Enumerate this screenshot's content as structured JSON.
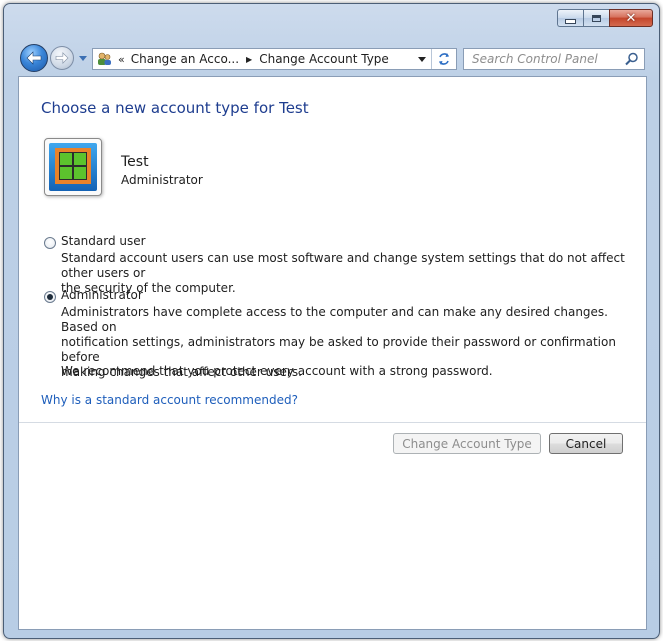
{
  "window": {
    "caption_buttons": [
      "minimize",
      "maximize",
      "close"
    ]
  },
  "navigation": {
    "back_icon": "back-arrow-icon",
    "forward_icon": "forward-arrow-icon",
    "breadcrumb_overflow": "«",
    "breadcrumbs": [
      "Change an Acco...",
      "Change Account Type"
    ],
    "refresh_icon": "refresh-icon"
  },
  "search": {
    "placeholder": "Search Control Panel",
    "icon": "magnifier-icon"
  },
  "page": {
    "heading": "Choose a new account type for Test"
  },
  "user": {
    "name": "Test",
    "role": "Administrator"
  },
  "options": [
    {
      "label": "Standard user",
      "selected": false,
      "description_lines": [
        "Standard account users can use most software and change system settings that do not affect other users or",
        "the security of the computer."
      ]
    },
    {
      "label": "Administrator",
      "selected": true,
      "description_lines": [
        "Administrators have complete access to the computer and can make any desired changes. Based on",
        "notification settings, administrators may be asked to provide their password or confirmation before",
        "making changes that affect other users."
      ]
    }
  ],
  "recommendation": "We recommend that you protect every account with a strong password.",
  "help_link": "Why is a standard account recommended?",
  "buttons": {
    "change": "Change Account Type",
    "cancel": "Cancel"
  },
  "colors": {
    "heading": "#1e3d8f",
    "link": "#1e5ebb",
    "window_frame": "#b8cde5"
  }
}
